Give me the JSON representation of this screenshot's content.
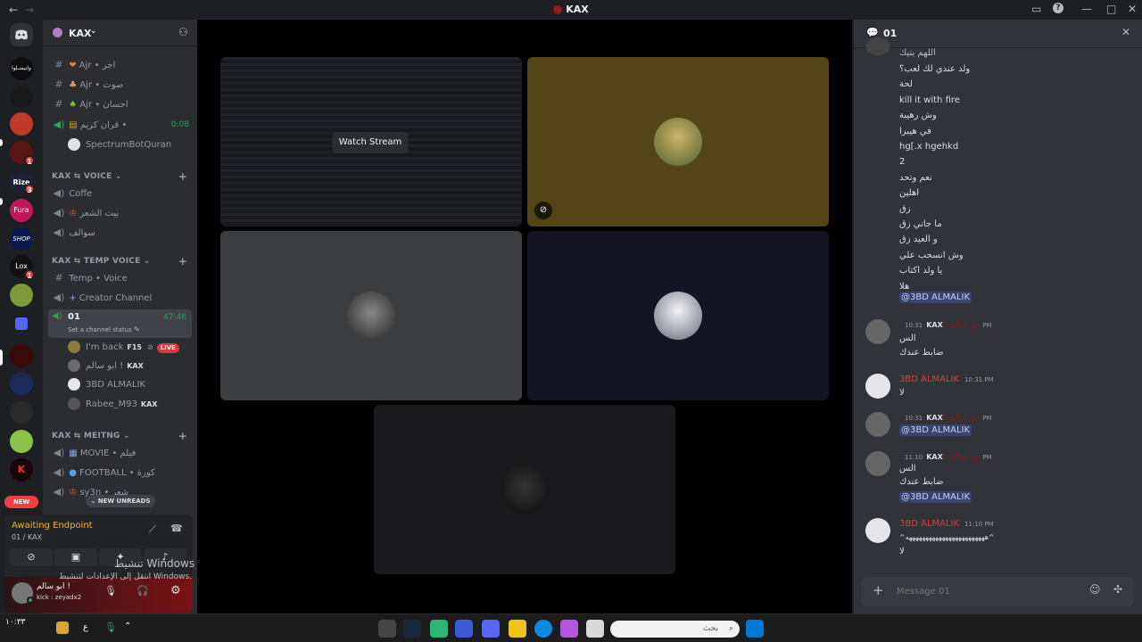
{
  "window": {
    "title": "KAX"
  },
  "server": {
    "name": "KAX"
  },
  "channels": {
    "text_top": [
      {
        "name": "Ajr • اجر"
      },
      {
        "name": "Ajr • صوت"
      },
      {
        "name": "Ajr • احسان"
      }
    ],
    "quran_voice": {
      "name": "قران كريم •",
      "time": "0:08"
    },
    "quran_bot": {
      "name": "SpectrumBotQuran"
    },
    "cat_voice": "KAX ⇆ VOICE",
    "voice": [
      {
        "name": "Coffe"
      },
      {
        "name": "بيت الشعر"
      },
      {
        "name": "سوالف"
      }
    ],
    "cat_temp": "KAX ⇆ TEMP VOICE",
    "temp": [
      {
        "name": "Temp • Voice"
      },
      {
        "name": "Creator Channel"
      }
    ],
    "active": {
      "name": "01",
      "time": "47:46",
      "status": "Set a channel status"
    },
    "members": [
      {
        "name": "I'm back",
        "tag": "F15",
        "live": "LIVE"
      },
      {
        "name": "ابو سالم !",
        "tag": "KAX"
      },
      {
        "name": "3BD ALMALIK"
      },
      {
        "name": "Rabee_M93",
        "tag": "KAX"
      }
    ],
    "cat_meeting": "KAX ⇆ MEITNG",
    "meeting": [
      {
        "name": "MOVIE • فيلم"
      },
      {
        "name": "FOOTBALL • كورة"
      },
      {
        "name": "sy3n • شعر"
      }
    ],
    "new_unreads": "NEW UNREADS"
  },
  "rail": {
    "new_label": "NEW",
    "badges": [
      "1",
      "3",
      "1"
    ]
  },
  "voice_panel": {
    "status": "Awaiting Endpoint",
    "channel": "01 / KAX",
    "user_name": "ابو سالم !",
    "user_sub": "kick : zeyadx2"
  },
  "stage": {
    "watch_stream": "Watch Stream"
  },
  "chat": {
    "title": "01",
    "header_partial": "اللهم يتيك",
    "lines_top": [
      "ولد عندي لك لعب؟",
      "لحة",
      "kill it with fire",
      "وش رهيبة",
      "في هيبرا",
      "hg[.x hgehkd",
      "2",
      "نعم وتحد",
      "اهلين",
      "زق",
      "ما جاني زق",
      "و العيد زق",
      "وش انسحب علي",
      "يا ولد اكتاب",
      "هلا"
    ],
    "mention": "@3BD ALMALIK",
    "messages": [
      {
        "author": "ابو سالم !",
        "tag": "KAX",
        "time": "10:31 PM",
        "lines": [
          "الس",
          "ضابط عندك"
        ]
      },
      {
        "author": "3BD ALMALIK",
        "time": "10:31 PM",
        "lines": [
          "لا"
        ]
      },
      {
        "author": "ابو سالم !",
        "tag": "KAX",
        "time": "10:31 PM",
        "mention": "@3BD ALMALIK"
      },
      {
        "author": "ابو سالم !",
        "tag": "KAX",
        "time": "11:10 PM",
        "lines": [
          "الس",
          "ضابط عندك"
        ],
        "mention": "@3BD ALMALIK"
      },
      {
        "author": "3BD ALMALIK",
        "time": "11:10 PM",
        "lines": [
          "^ههههههههههههههههههههههههه^",
          "لا"
        ]
      }
    ],
    "composer_placeholder": "Message 01"
  },
  "watermark": {
    "line1": "تنشيط Windows",
    "line2": "انتقل إلى الإعدادات لتنشيط Windows."
  },
  "taskbar": {
    "search_placeholder": "بحث",
    "time": "١٠:٣٣",
    "lang": "ع"
  },
  "colors": {
    "live": "#da373c",
    "green": "#23a55a",
    "mention_bg": "#3c4270",
    "author_red": "#e03b3b"
  }
}
